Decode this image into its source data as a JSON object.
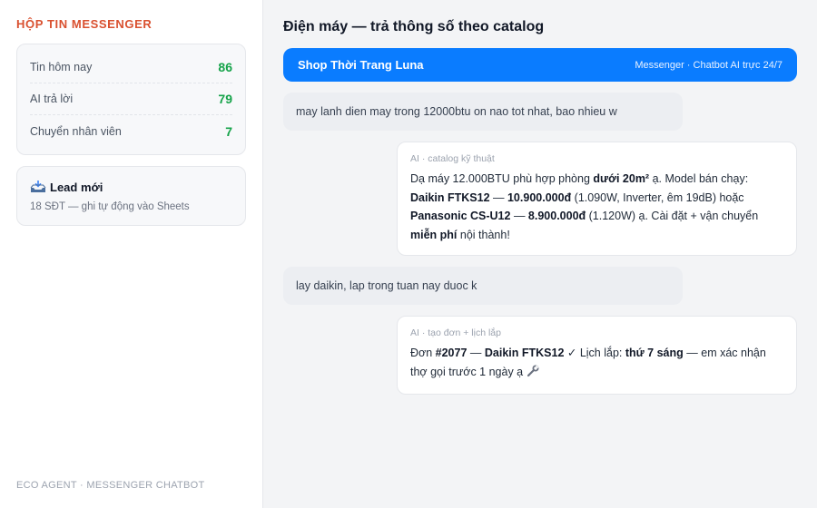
{
  "sidebar": {
    "title": "HỘP TIN MESSENGER",
    "stats": [
      {
        "label": "Tin hôm nay",
        "value": "86"
      },
      {
        "label": "AI trả lời",
        "value": "79"
      },
      {
        "label": "Chuyển nhân viên",
        "value": "7"
      }
    ],
    "lead": {
      "icon": "inbox-tray-icon",
      "title": "Lead mới",
      "subtitle": "18 SĐT — ghi tự động vào Sheets"
    },
    "footer": "ECO AGENT · MESSENGER CHATBOT"
  },
  "main": {
    "title": "Điện máy — trả thông số theo catalog",
    "header": {
      "shop_name": "Shop Thời Trang Luna",
      "meta": "Messenger · Chatbot AI trực 24/7"
    },
    "messages": [
      {
        "role": "user",
        "text": "may lanh dien may trong 12000btu on nao tot nhat, bao nhieu w"
      },
      {
        "role": "ai",
        "tag": "AI · catalog kỹ thuật",
        "parts": {
          "p1": "Dạ máy 12.000BTU phù hợp phòng ",
          "b1": "dưới 20m²",
          "p2": " ạ. Model bán chạy: ",
          "b2": "Daikin FTKS12",
          "p3": " — ",
          "b3": "10.900.000đ",
          "p4": " (1.090W, Inverter, êm 19dB) hoặc ",
          "b4": "Panasonic CS-U12",
          "p5": " — ",
          "b5": "8.900.000đ",
          "p6": " (1.120W) ạ. Cài đặt + vận chuyển ",
          "b6": "miễn phí",
          "p7": " nội thành!"
        }
      },
      {
        "role": "user",
        "text": "lay daikin, lap trong tuan nay duoc k"
      },
      {
        "role": "ai",
        "tag": "AI · tạo đơn + lịch lắp",
        "parts": {
          "p1": "Đơn ",
          "b1": "#2077",
          "p2": " — ",
          "b2": "Daikin FTKS12",
          "p3": " ✓ Lịch lắp: ",
          "b3": "thứ 7 sáng",
          "p4": " — em xác nhận thợ gọi trước 1 ngày ạ ",
          "icon": "wrench-icon"
        }
      }
    ]
  },
  "colors": {
    "accent": "#0a7cff",
    "sidebar_title": "#d9502f",
    "stat_value": "#16a34a"
  }
}
